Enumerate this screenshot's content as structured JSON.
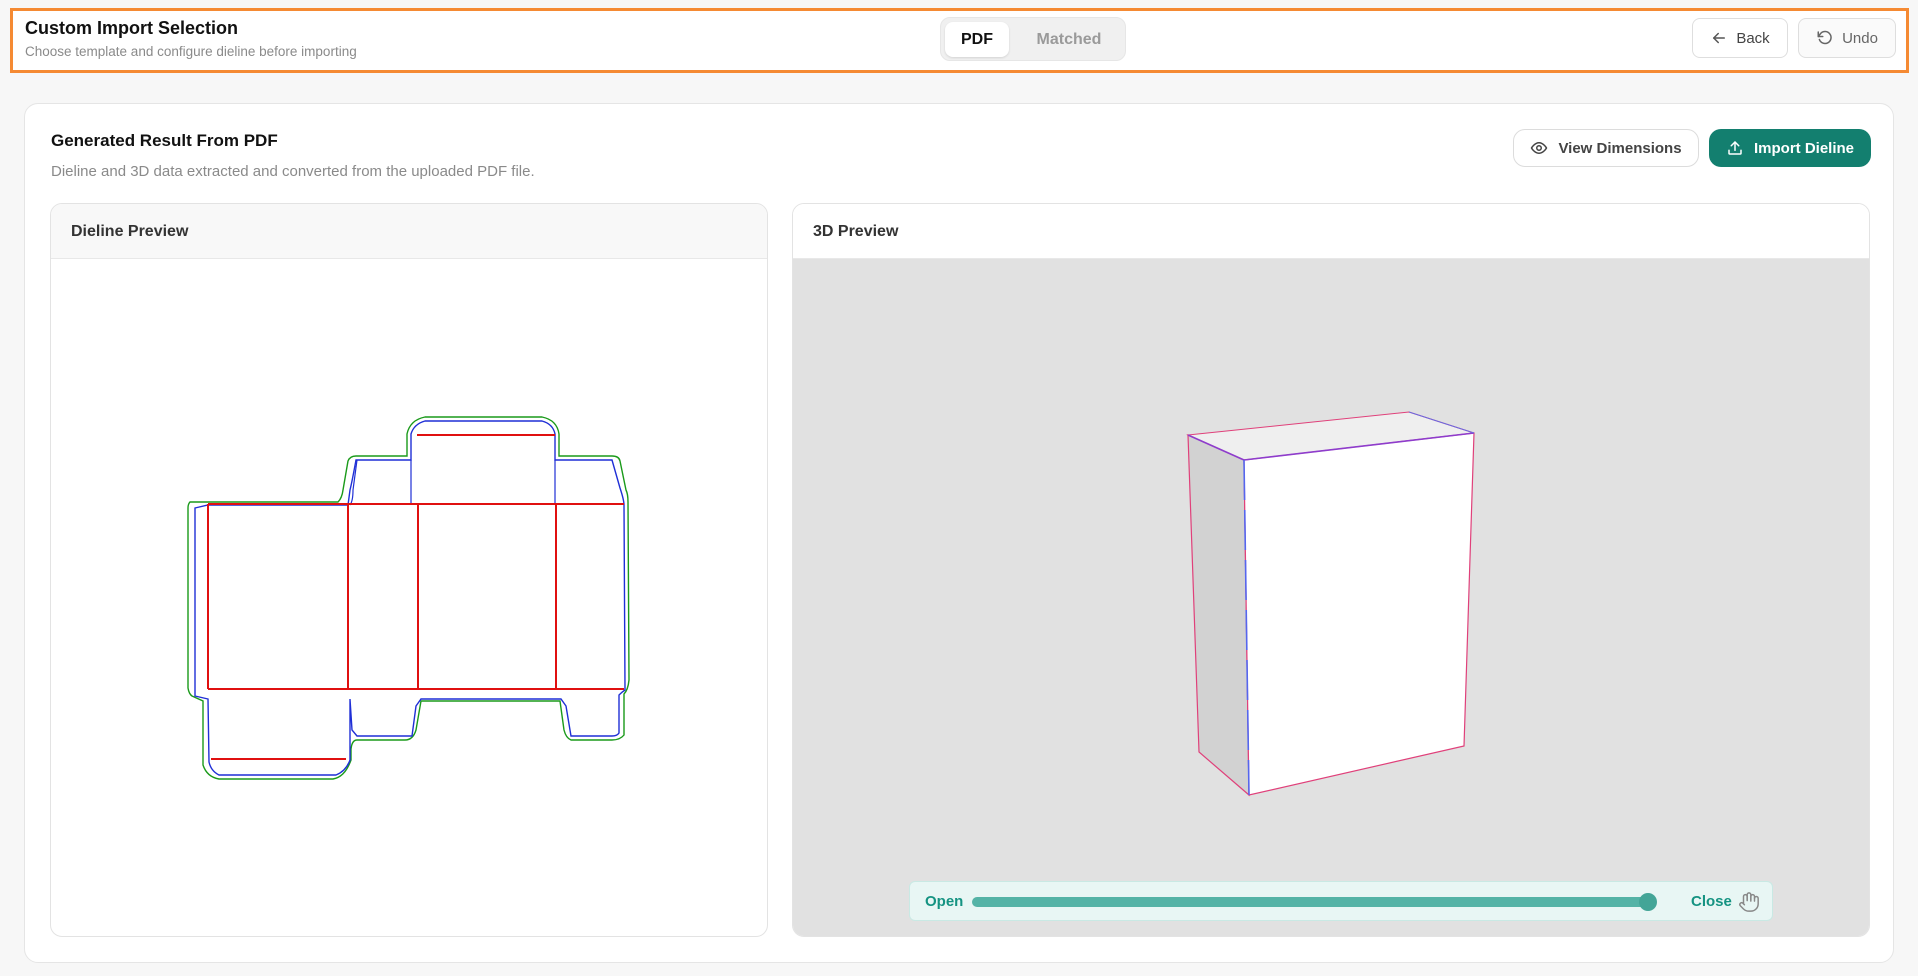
{
  "header": {
    "title": "Custom Import Selection",
    "subtitle": "Choose template and configure dieline before importing",
    "tabs": [
      {
        "label": "PDF",
        "active": true
      },
      {
        "label": "Matched",
        "active": false
      }
    ],
    "back_label": "Back",
    "undo_label": "Undo",
    "icons": [
      "arrow-left-icon",
      "undo-icon"
    ]
  },
  "main": {
    "title": "Generated Result From PDF",
    "description": "Dieline and 3D data extracted and converted from the uploaded PDF file.",
    "view_dimensions_label": "View Dimensions",
    "import_label": "Import Dieline",
    "icons": [
      "eye-icon",
      "upload-icon",
      "hand-icon"
    ],
    "dieline_panel": {
      "title": "Dieline Preview"
    },
    "preview_panel": {
      "title": "3D Preview",
      "slider": {
        "open_label": "Open",
        "close_label": "Close",
        "value": 1.0
      }
    }
  },
  "colors": {
    "accent": "#137f6f",
    "header_border": "#f58a33",
    "cut_line": "#1f2fd6",
    "fold_line": "#e01010",
    "bleed_line": "#1a9a1a",
    "edge_line": "#e0407a"
  }
}
